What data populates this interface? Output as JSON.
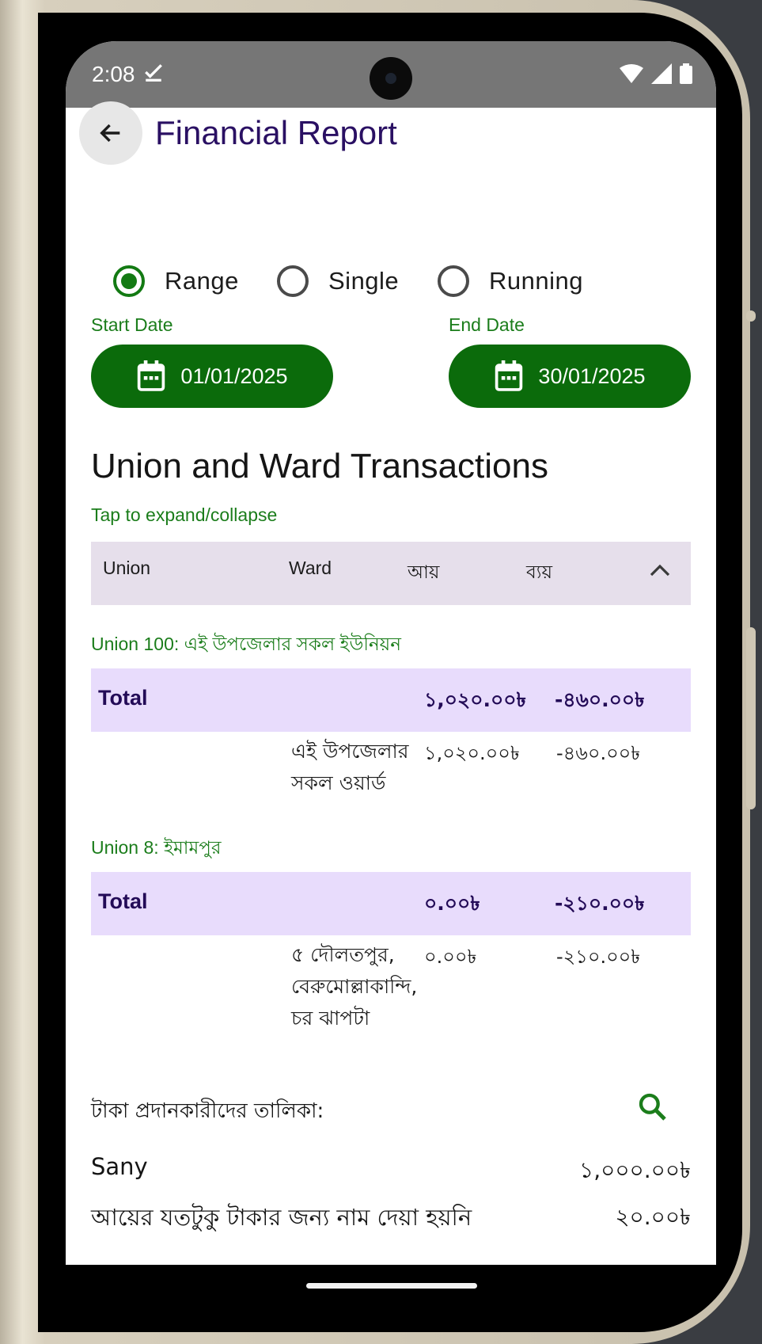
{
  "status_bar": {
    "time": "2:08"
  },
  "app_bar": {
    "title": "Financial Report"
  },
  "report_type": {
    "options": [
      "Range",
      "Single",
      "Running"
    ],
    "selected": "Range"
  },
  "start_date": {
    "label": "Start Date",
    "value": "01/01/2025"
  },
  "end_date": {
    "label": "End Date",
    "value": "30/01/2025"
  },
  "section": {
    "title": "Union and Ward Transactions",
    "hint": "Tap to expand/collapse"
  },
  "table": {
    "headers": [
      "Union",
      "Ward",
      "আয়",
      "ব্যয়"
    ],
    "unions": [
      {
        "label": "Union 100: এই উপজেলার সকল ইউনিয়ন",
        "total_label": "Total",
        "total_income": "১,০২০.০০৳",
        "total_expense": "-৪৬০.০০৳",
        "ward": "এই উপজেলার সকল ওয়ার্ড",
        "income": "১,০২০.০০৳",
        "expense": "-৪৬০.০০৳"
      },
      {
        "label": "Union 8: ইমামপুর",
        "total_label": "Total",
        "total_income": "০.০০৳",
        "total_expense": "-২১০.০০৳",
        "ward": "৫ দৌলতপুর, বেরুমোল্লাকান্দি, চর ঝাপটা",
        "income": "০.০০৳",
        "expense": "-২১০.০০৳"
      }
    ]
  },
  "donors": {
    "title": "টাকা প্রদানকারীদের তালিকা:",
    "items": [
      {
        "name": "Sany",
        "amount": "১,০০০.০০৳"
      },
      {
        "name": "আয়ের যতটুকু টাকার জন্য নাম দেয়া হয়নি",
        "amount": "২০.০০৳"
      }
    ]
  },
  "colors": {
    "primary_green": "#0b6b0b",
    "title_purple": "#2a1063",
    "total_row_bg": "#e8dcfc",
    "header_bg": "#e6dfeb"
  }
}
